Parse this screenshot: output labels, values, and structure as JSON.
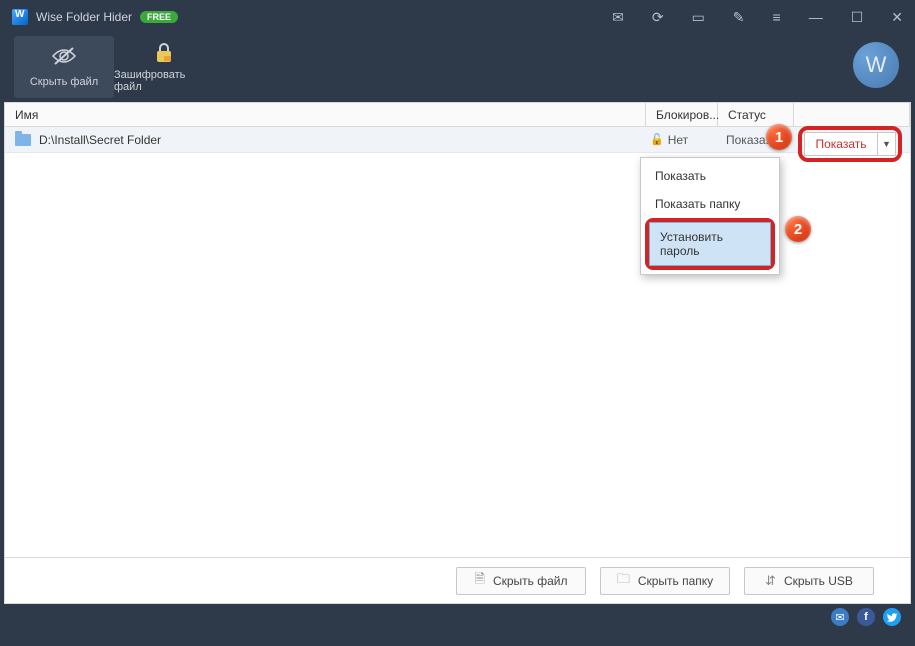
{
  "title": "Wise Folder Hider",
  "free_badge": "FREE",
  "toolbar": {
    "hide_file": "Скрыть файл",
    "encrypt_file": "Зашифровать файл"
  },
  "columns": {
    "name": "Имя",
    "lock": "Блокиров...",
    "status": "Статус"
  },
  "row": {
    "path": "D:\\Install\\Secret Folder",
    "lock": "Нет",
    "status": "Показа..."
  },
  "show_button": "Показать",
  "menu": {
    "show": "Показать",
    "show_folder": "Показать папку",
    "set_password": "Установить пароль"
  },
  "actions": {
    "hide_file": "Скрыть файл",
    "hide_folder": "Скрыть папку",
    "hide_usb": "Скрыть USB"
  },
  "badges": {
    "one": "1",
    "two": "2"
  },
  "logo": "W"
}
